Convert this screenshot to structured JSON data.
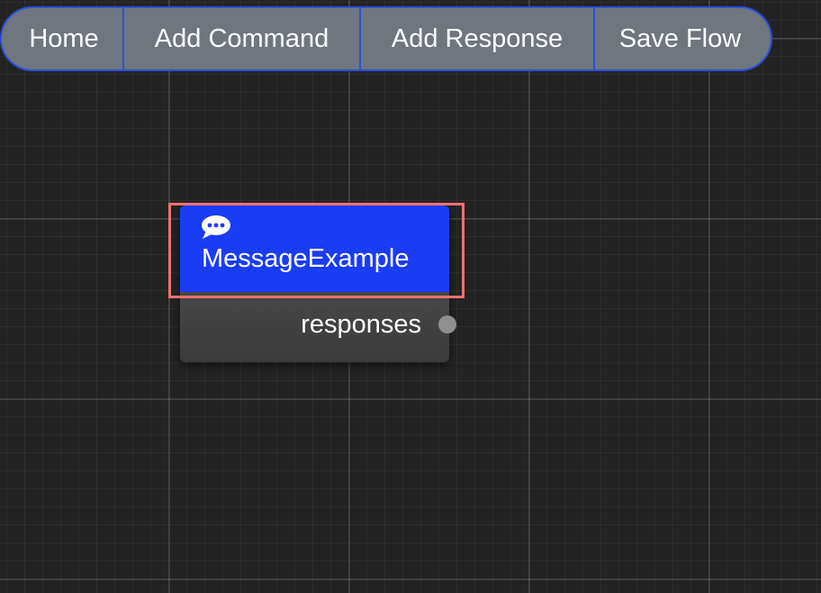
{
  "toolbar": {
    "home_label": "Home",
    "add_command_label": "Add Command",
    "add_response_label": "Add Response",
    "save_flow_label": "Save Flow"
  },
  "node": {
    "title": "MessageExample",
    "icon": "speech-bubble-icon",
    "output_port_label": "responses",
    "selected": true
  },
  "colors": {
    "canvas_background": "#232323",
    "toolbar_background": "#6f767e",
    "toolbar_border": "#2b4fe0",
    "node_header": "#1b3cf5",
    "node_body": "#3f3f3f",
    "selection_outline": "#f07070",
    "port": "#8f8f8f"
  }
}
